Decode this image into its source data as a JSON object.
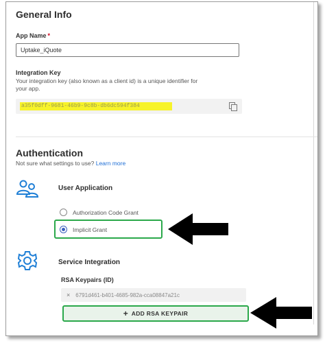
{
  "general": {
    "title": "General Info",
    "app_name_label": "App Name",
    "app_name_required_mark": "*",
    "app_name_value": "Uptake_iQuote",
    "integration_key_label": "Integration Key",
    "integration_key_help_line1": "Your integration key (also known as a client id) is a unique identifier for",
    "integration_key_help_line2": "your app.",
    "integration_key_value": "a35f0dff-9681-46b9-9c8b-db6dc594f384"
  },
  "auth": {
    "title": "Authentication",
    "help_text": "Not sure what settings to use?",
    "learn_more": "Learn more",
    "user_application": {
      "heading": "User Application",
      "icon": "users-icon",
      "options": [
        {
          "label": "Authorization Code Grant",
          "selected": false
        },
        {
          "label": "Implicit Grant",
          "selected": true
        }
      ]
    },
    "service_integration": {
      "heading": "Service Integration",
      "icon": "gear-icon",
      "rsa_label": "RSA Keypairs (ID)",
      "keypair_id": "6791d461-b401-4685-982a-cca08847a21c",
      "remove_glyph": "×",
      "add_button": "ADD RSA KEYPAIR",
      "add_glyph": "+"
    }
  },
  "colors": {
    "accent_blue": "#1f6fd6",
    "icon_blue": "#1f7fd6",
    "highlight_yellow": "#f7f32a",
    "callout_green": "#2aa84a",
    "arrow_black": "#000000"
  }
}
